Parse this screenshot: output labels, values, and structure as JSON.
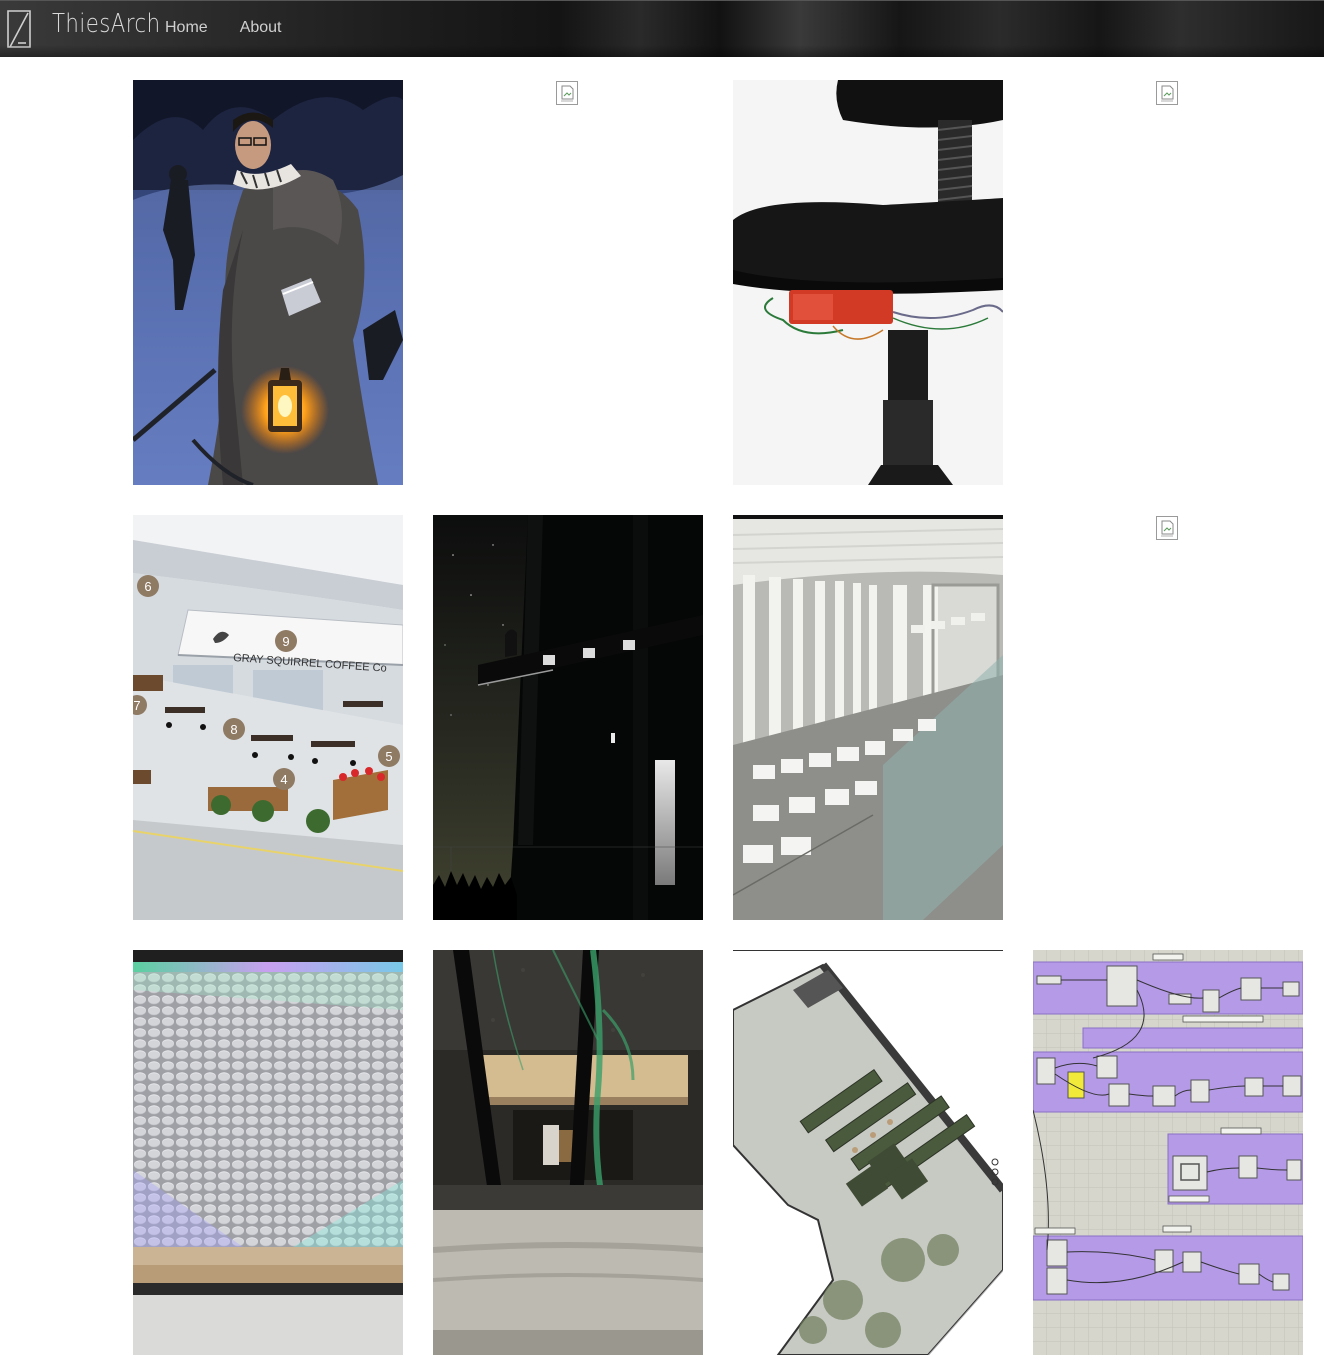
{
  "header": {
    "logo_text": "ThiesArch",
    "nav": [
      {
        "label": "Home"
      },
      {
        "label": "About"
      }
    ]
  },
  "gallery": {
    "rows": [
      [
        {
          "subject": "person in cloak holding lantern in snow",
          "status": "loaded"
        },
        {
          "subject": "broken image",
          "status": "missing"
        },
        {
          "subject": "office chair with red sensor box and wires",
          "status": "loaded"
        },
        {
          "subject": "broken image",
          "status": "missing"
        }
      ],
      [
        {
          "subject": "site plan render with numbered markers",
          "status": "loaded",
          "signage": "GRAY SQUIRREL COFFEE Co",
          "markers": [
            "6",
            "9",
            "7",
            "8",
            "5",
            "4"
          ]
        },
        {
          "subject": "night silhouette of tower structure",
          "status": "loaded"
        },
        {
          "subject": "interior render with columns and seating",
          "status": "loaded"
        },
        {
          "subject": "broken image",
          "status": "missing"
        }
      ],
      [
        {
          "subject": "installation with grid of round discs and LED lights",
          "status": "loaded"
        },
        {
          "subject": "physical model close-up with wire tree",
          "status": "loaded"
        },
        {
          "subject": "landscape plan with planter beds",
          "status": "loaded"
        },
        {
          "subject": "grasshopper script node graph",
          "status": "loaded"
        }
      ]
    ]
  },
  "colors": {
    "header_bg": "#1e1e1e",
    "nav_text": "#cfcfcf",
    "logo_text": "#d9d9d9",
    "page_bg": "#ffffff",
    "grasshopper_group": "#b59ae8"
  }
}
